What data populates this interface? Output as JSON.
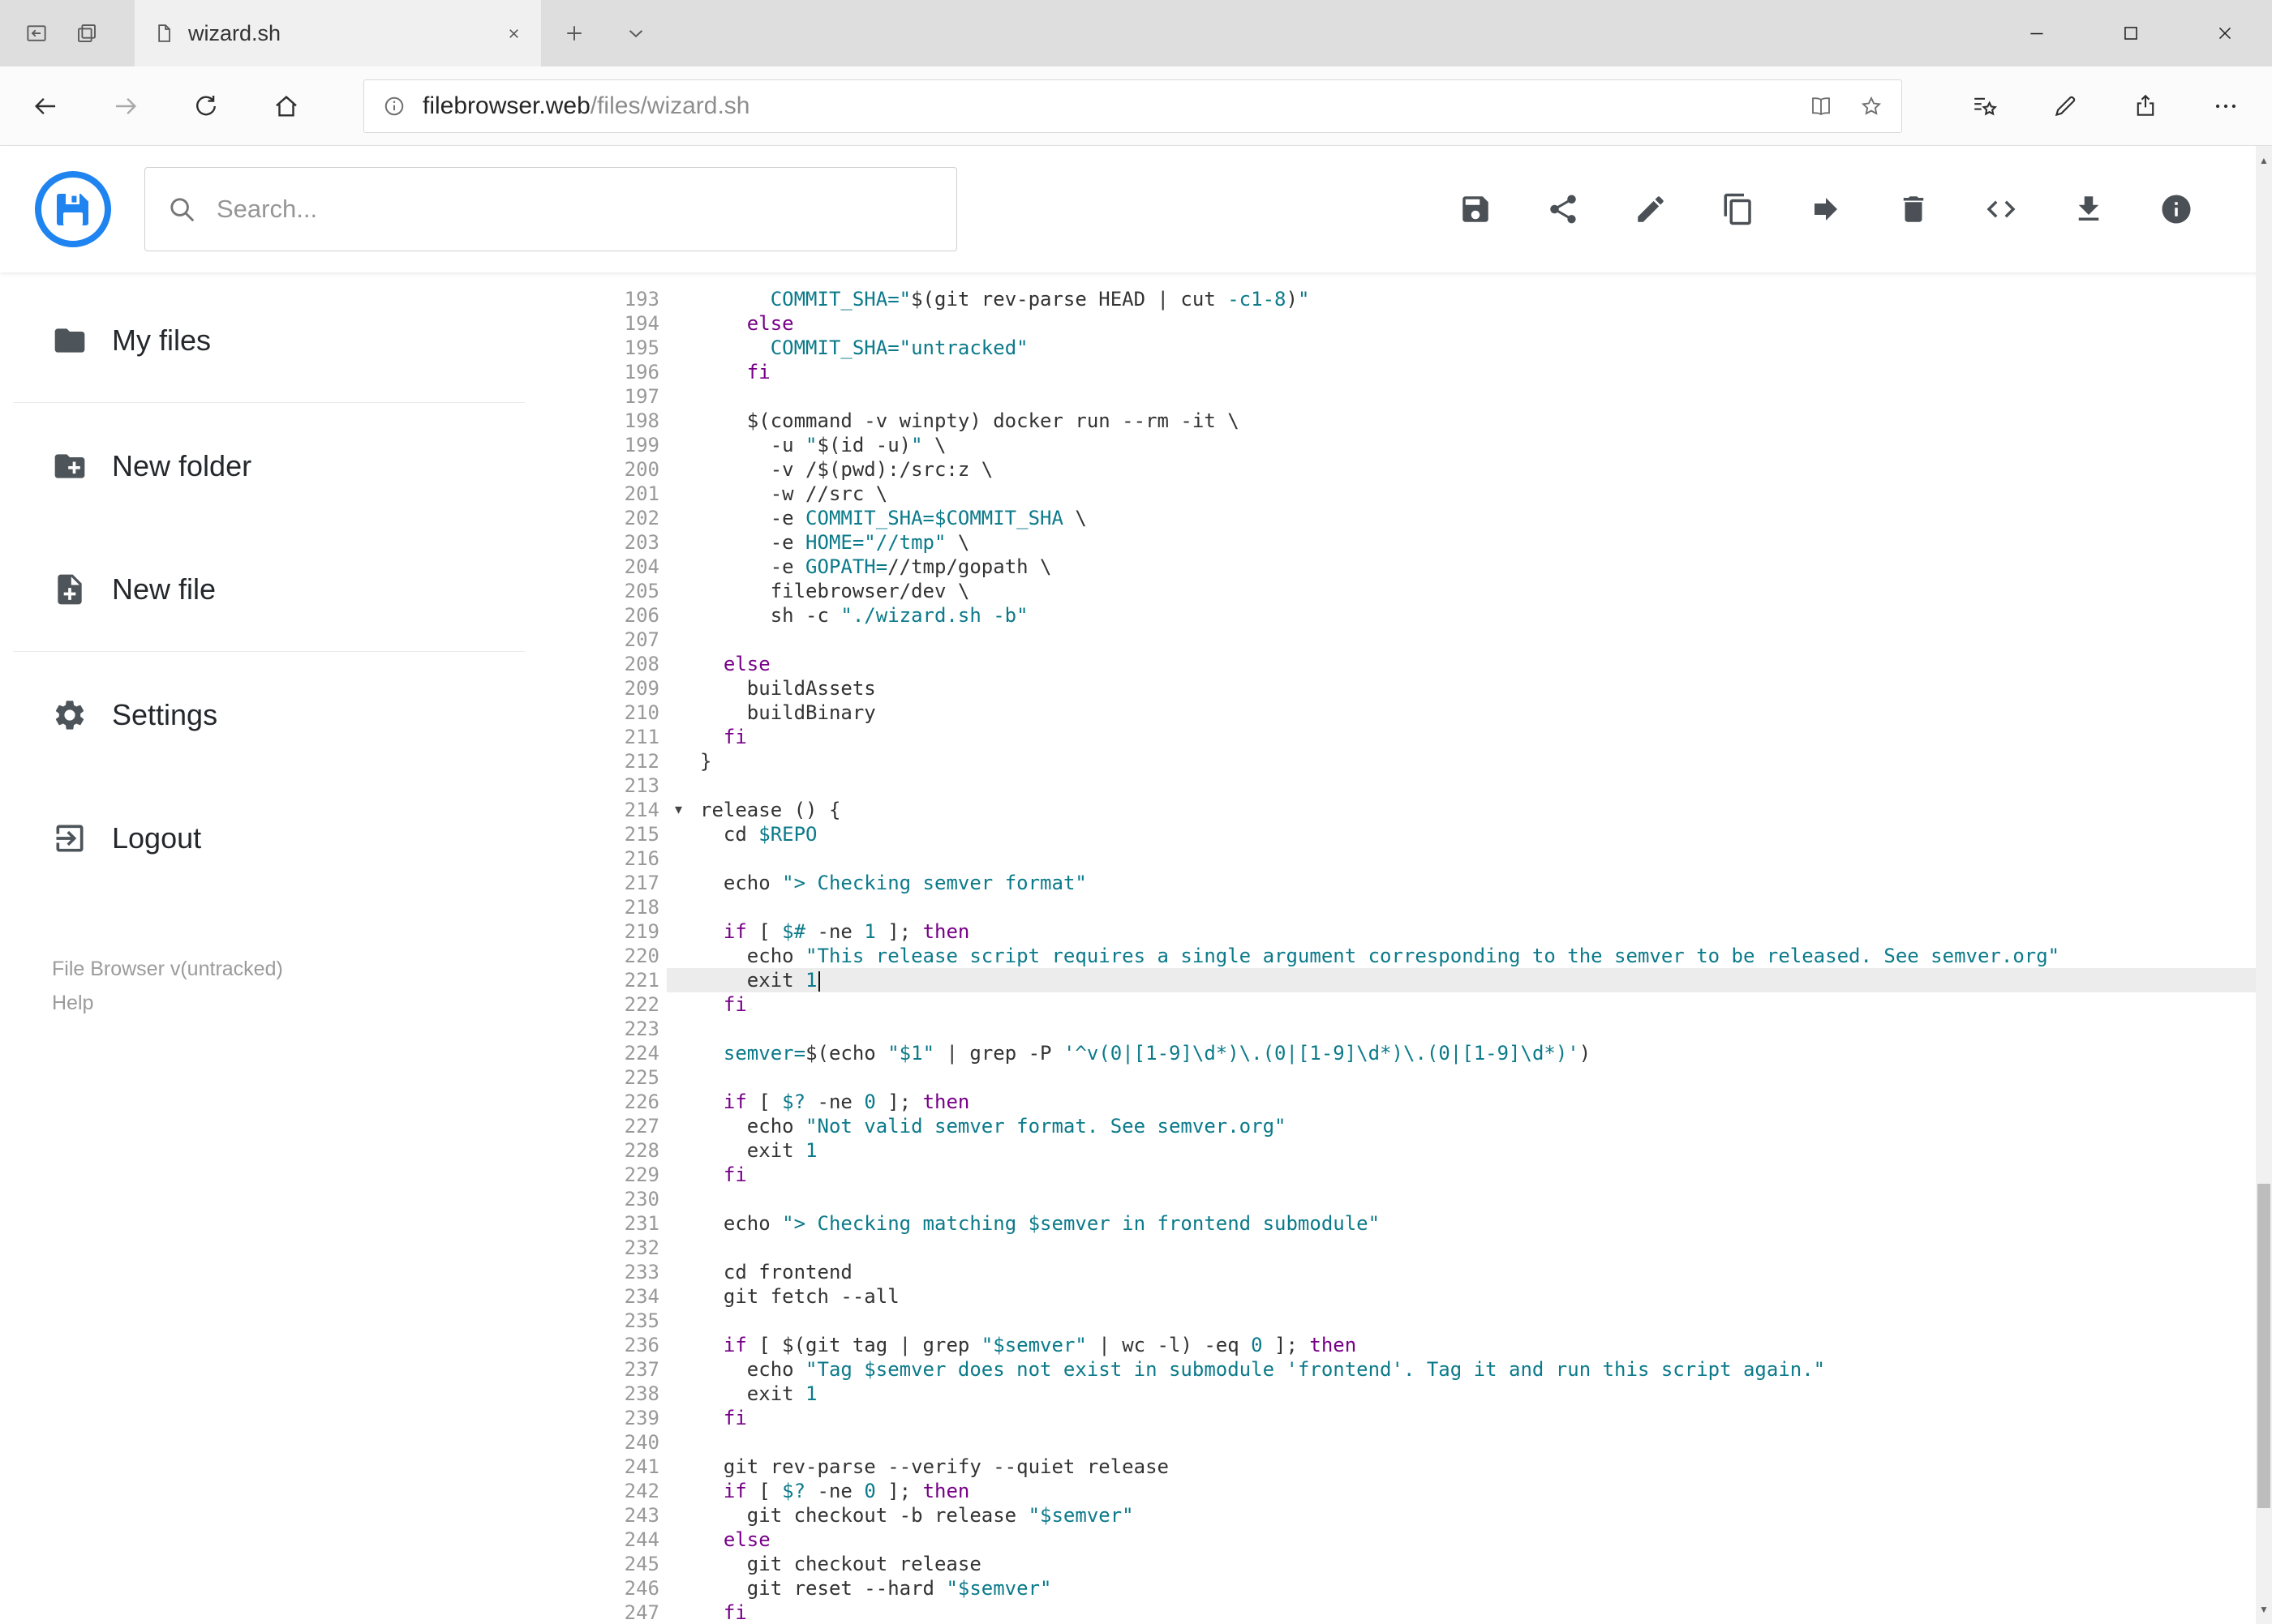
{
  "browser": {
    "tab_title": "wizard.sh",
    "url_host": "filebrowser.web",
    "url_path": "/files/wizard.sh"
  },
  "header": {
    "search_placeholder": "Search...",
    "toolbar": [
      {
        "name": "save",
        "icon": "save"
      },
      {
        "name": "share",
        "icon": "share"
      },
      {
        "name": "edit",
        "icon": "edit"
      },
      {
        "name": "copy",
        "icon": "copy"
      },
      {
        "name": "move",
        "icon": "move"
      },
      {
        "name": "delete",
        "icon": "delete"
      },
      {
        "name": "code",
        "icon": "code"
      },
      {
        "name": "download",
        "icon": "download"
      },
      {
        "name": "info",
        "icon": "info"
      }
    ]
  },
  "sidebar": {
    "items": [
      {
        "label": "My files",
        "icon": "folder"
      },
      {
        "label": "New folder",
        "icon": "new-folder"
      },
      {
        "label": "New file",
        "icon": "new-file"
      },
      {
        "label": "Settings",
        "icon": "settings"
      },
      {
        "label": "Logout",
        "icon": "logout"
      }
    ],
    "divider_after": [
      0,
      2
    ],
    "footer": {
      "version": "File Browser v(untracked)",
      "help": "Help"
    }
  },
  "editor": {
    "active_line": 221,
    "cursor_line": 221,
    "fold_line": 214,
    "lines": [
      {
        "n": 193,
        "tk": [
          [
            "p",
            "      "
          ],
          [
            "t",
            "COMMIT_SHA=\""
          ],
          [
            "p",
            "$(git rev-parse HEAD | cut "
          ],
          [
            "t",
            "-c1-8"
          ],
          [
            "p",
            ")"
          ],
          [
            "t",
            "\""
          ]
        ]
      },
      {
        "n": 194,
        "tk": [
          [
            "p",
            "    "
          ],
          [
            "k",
            "else"
          ]
        ]
      },
      {
        "n": 195,
        "tk": [
          [
            "p",
            "      "
          ],
          [
            "t",
            "COMMIT_SHA="
          ],
          [
            "t",
            "\"untracked\""
          ]
        ]
      },
      {
        "n": 196,
        "tk": [
          [
            "p",
            "    "
          ],
          [
            "k",
            "fi"
          ]
        ]
      },
      {
        "n": 197,
        "tk": []
      },
      {
        "n": 198,
        "tk": [
          [
            "p",
            "    $(command -v winpty) docker run --rm -it \\"
          ]
        ]
      },
      {
        "n": 199,
        "tk": [
          [
            "p",
            "      -u "
          ],
          [
            "t",
            "\""
          ],
          [
            "p",
            "$(id -u)"
          ],
          [
            "t",
            "\""
          ],
          [
            "p",
            " \\"
          ]
        ]
      },
      {
        "n": 200,
        "tk": [
          [
            "p",
            "      -v /$(pwd):/src:z \\"
          ]
        ]
      },
      {
        "n": 201,
        "tk": [
          [
            "p",
            "      -w //src \\"
          ]
        ]
      },
      {
        "n": 202,
        "tk": [
          [
            "p",
            "      -e "
          ],
          [
            "t",
            "COMMIT_SHA=$COMMIT_SHA"
          ],
          [
            "p",
            " \\"
          ]
        ]
      },
      {
        "n": 203,
        "tk": [
          [
            "p",
            "      -e "
          ],
          [
            "t",
            "HOME="
          ],
          [
            "t",
            "\"//tmp\""
          ],
          [
            "p",
            " \\"
          ]
        ]
      },
      {
        "n": 204,
        "tk": [
          [
            "p",
            "      -e "
          ],
          [
            "t",
            "GOPATH="
          ],
          [
            "p",
            "//tmp/gopath \\"
          ]
        ]
      },
      {
        "n": 205,
        "tk": [
          [
            "p",
            "      filebrowser/dev \\"
          ]
        ]
      },
      {
        "n": 206,
        "tk": [
          [
            "p",
            "      sh -c "
          ],
          [
            "t",
            "\"./wizard.sh -b\""
          ]
        ]
      },
      {
        "n": 207,
        "tk": []
      },
      {
        "n": 208,
        "tk": [
          [
            "p",
            "  "
          ],
          [
            "k",
            "else"
          ]
        ]
      },
      {
        "n": 209,
        "tk": [
          [
            "p",
            "    buildAssets"
          ]
        ]
      },
      {
        "n": 210,
        "tk": [
          [
            "p",
            "    buildBinary"
          ]
        ]
      },
      {
        "n": 211,
        "tk": [
          [
            "p",
            "  "
          ],
          [
            "k",
            "fi"
          ]
        ]
      },
      {
        "n": 212,
        "tk": [
          [
            "p",
            "}"
          ]
        ]
      },
      {
        "n": 213,
        "tk": []
      },
      {
        "n": 214,
        "tk": [
          [
            "p",
            "release () {"
          ]
        ]
      },
      {
        "n": 215,
        "tk": [
          [
            "p",
            "  cd "
          ],
          [
            "t",
            "$REPO"
          ]
        ]
      },
      {
        "n": 216,
        "tk": []
      },
      {
        "n": 217,
        "tk": [
          [
            "p",
            "  echo "
          ],
          [
            "t",
            "\"> Checking semver format\""
          ]
        ]
      },
      {
        "n": 218,
        "tk": []
      },
      {
        "n": 219,
        "tk": [
          [
            "p",
            "  "
          ],
          [
            "k",
            "if"
          ],
          [
            "p",
            " [ "
          ],
          [
            "t",
            "$#"
          ],
          [
            "p",
            " -ne "
          ],
          [
            "t",
            "1"
          ],
          [
            "p",
            " ]; "
          ],
          [
            "k",
            "then"
          ]
        ]
      },
      {
        "n": 220,
        "tk": [
          [
            "p",
            "    echo "
          ],
          [
            "t",
            "\"This release script requires a single argument corresponding to the semver to be released. See semver.org\""
          ]
        ]
      },
      {
        "n": 221,
        "tk": [
          [
            "p",
            "    exit "
          ],
          [
            "t",
            "1"
          ]
        ]
      },
      {
        "n": 222,
        "tk": [
          [
            "p",
            "  "
          ],
          [
            "k",
            "fi"
          ]
        ]
      },
      {
        "n": 223,
        "tk": []
      },
      {
        "n": 224,
        "tk": [
          [
            "p",
            "  "
          ],
          [
            "t",
            "semver="
          ],
          [
            "p",
            "$(echo "
          ],
          [
            "t",
            "\"$1\""
          ],
          [
            "p",
            " | grep -P "
          ],
          [
            "t",
            "'^v(0|[1-9]\\d*)\\.(0|[1-9]\\d*)\\.(0|[1-9]\\d*)'"
          ],
          [
            "p",
            ")"
          ]
        ]
      },
      {
        "n": 225,
        "tk": []
      },
      {
        "n": 226,
        "tk": [
          [
            "p",
            "  "
          ],
          [
            "k",
            "if"
          ],
          [
            "p",
            " [ "
          ],
          [
            "t",
            "$?"
          ],
          [
            "p",
            " -ne "
          ],
          [
            "t",
            "0"
          ],
          [
            "p",
            " ]; "
          ],
          [
            "k",
            "then"
          ]
        ]
      },
      {
        "n": 227,
        "tk": [
          [
            "p",
            "    echo "
          ],
          [
            "t",
            "\"Not valid semver format. See semver.org\""
          ]
        ]
      },
      {
        "n": 228,
        "tk": [
          [
            "p",
            "    exit "
          ],
          [
            "t",
            "1"
          ]
        ]
      },
      {
        "n": 229,
        "tk": [
          [
            "p",
            "  "
          ],
          [
            "k",
            "fi"
          ]
        ]
      },
      {
        "n": 230,
        "tk": []
      },
      {
        "n": 231,
        "tk": [
          [
            "p",
            "  echo "
          ],
          [
            "t",
            "\"> Checking matching $semver in frontend submodule\""
          ]
        ]
      },
      {
        "n": 232,
        "tk": []
      },
      {
        "n": 233,
        "tk": [
          [
            "p",
            "  cd frontend"
          ]
        ]
      },
      {
        "n": 234,
        "tk": [
          [
            "p",
            "  git fetch --all"
          ]
        ]
      },
      {
        "n": 235,
        "tk": []
      },
      {
        "n": 236,
        "tk": [
          [
            "p",
            "  "
          ],
          [
            "k",
            "if"
          ],
          [
            "p",
            " [ $(git tag | grep "
          ],
          [
            "t",
            "\"$semver\""
          ],
          [
            "p",
            " | wc -l) -eq "
          ],
          [
            "t",
            "0"
          ],
          [
            "p",
            " ]; "
          ],
          [
            "k",
            "then"
          ]
        ]
      },
      {
        "n": 237,
        "tk": [
          [
            "p",
            "    echo "
          ],
          [
            "t",
            "\"Tag $semver does not exist in submodule 'frontend'. Tag it and run this script again.\""
          ]
        ]
      },
      {
        "n": 238,
        "tk": [
          [
            "p",
            "    exit "
          ],
          [
            "t",
            "1"
          ]
        ]
      },
      {
        "n": 239,
        "tk": [
          [
            "p",
            "  "
          ],
          [
            "k",
            "fi"
          ]
        ]
      },
      {
        "n": 240,
        "tk": []
      },
      {
        "n": 241,
        "tk": [
          [
            "p",
            "  git rev-parse --verify --quiet release"
          ]
        ]
      },
      {
        "n": 242,
        "tk": [
          [
            "p",
            "  "
          ],
          [
            "k",
            "if"
          ],
          [
            "p",
            " [ "
          ],
          [
            "t",
            "$?"
          ],
          [
            "p",
            " -ne "
          ],
          [
            "t",
            "0"
          ],
          [
            "p",
            " ]; "
          ],
          [
            "k",
            "then"
          ]
        ]
      },
      {
        "n": 243,
        "tk": [
          [
            "p",
            "    git checkout -b release "
          ],
          [
            "t",
            "\"$semver\""
          ]
        ]
      },
      {
        "n": 244,
        "tk": [
          [
            "p",
            "  "
          ],
          [
            "k",
            "else"
          ]
        ]
      },
      {
        "n": 245,
        "tk": [
          [
            "p",
            "    git checkout release"
          ]
        ]
      },
      {
        "n": 246,
        "tk": [
          [
            "p",
            "    git reset --hard "
          ],
          [
            "t",
            "\"$semver\""
          ]
        ]
      },
      {
        "n": 247,
        "tk": [
          [
            "p",
            "  "
          ],
          [
            "k",
            "fi"
          ]
        ]
      }
    ]
  },
  "colors": {
    "accent_blue": "#2084f0",
    "keyword_purple": "#770088",
    "literal_teal": "#0b7a8a",
    "code_text": "#333333",
    "active_line_bg": "#ececec",
    "line_number_gray": "#999999"
  }
}
